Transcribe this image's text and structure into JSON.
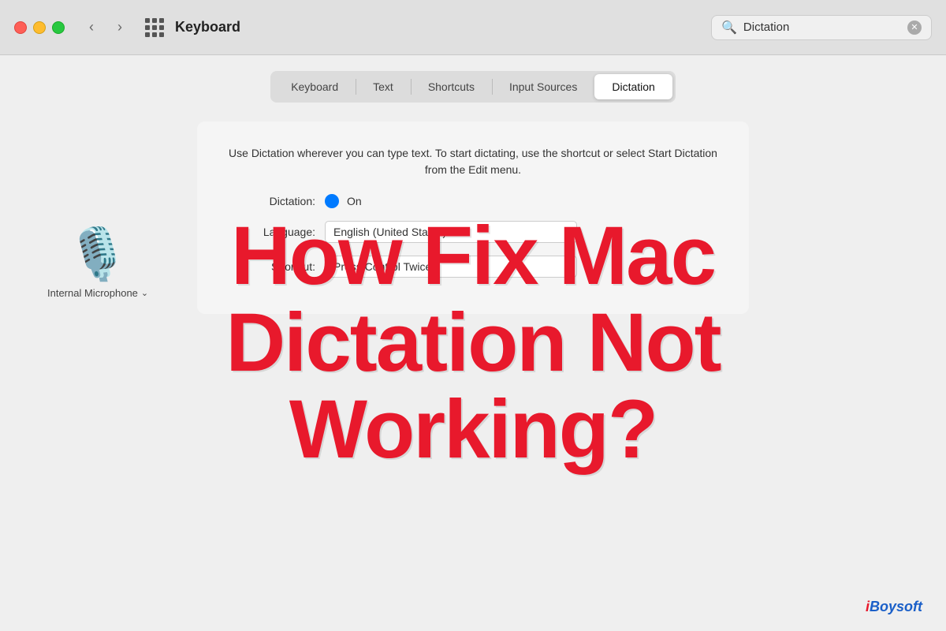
{
  "titlebar": {
    "title": "Keyboard",
    "back_label": "‹",
    "forward_label": "›",
    "search_placeholder": "Dictation",
    "search_value": "Dictation"
  },
  "tabs": [
    {
      "id": "keyboard",
      "label": "Keyboard",
      "active": false
    },
    {
      "id": "text",
      "label": "Text",
      "active": false
    },
    {
      "id": "shortcuts",
      "label": "Shortcuts",
      "active": false
    },
    {
      "id": "input-sources",
      "label": "Input Sources",
      "active": false
    },
    {
      "id": "dictation",
      "label": "Dictation",
      "active": true
    }
  ],
  "settings": {
    "description": "Use Dictation wherever you can type text. To start dictating, use the shortcut or select Start Dictation from the Edit menu.",
    "dictation_label": "Dictation:",
    "dictation_value": "On",
    "language_label": "Language:",
    "language_value": "English (United States)",
    "shortcut_label": "Shortcut:",
    "shortcut_value": "Press Control Twice"
  },
  "microphone": {
    "label": "Internal Microphone",
    "chevron": "⌄"
  },
  "overlay": {
    "line1": "How Fix Mac",
    "line2": "Dictation Not",
    "line3": "Working?"
  },
  "branding": {
    "prefix": "i",
    "suffix": "Boysoft"
  }
}
